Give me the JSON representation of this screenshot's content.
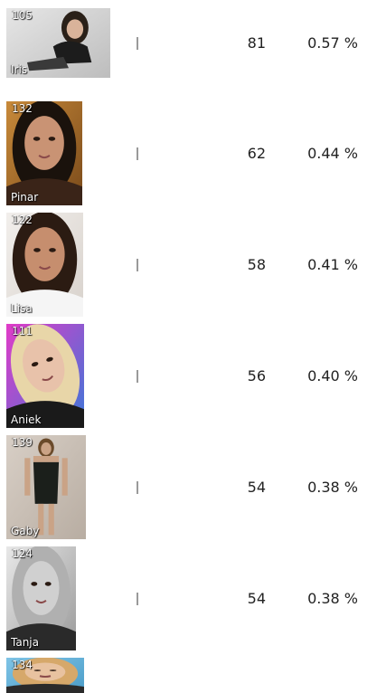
{
  "entries": [
    {
      "rank": "105",
      "name": "Iris",
      "votes": "81",
      "percent": "0.57 %",
      "bar_fraction": 0.57,
      "photo": {
        "bg": "#e6e6e6",
        "bg2": "#bdbdbd",
        "hair": "#2a2018",
        "skin": "#d9b39a",
        "cloth": "#1c1c1c",
        "pose": "lying"
      }
    },
    {
      "rank": "132",
      "name": "Pinar",
      "votes": "62",
      "percent": "0.44 %",
      "bar_fraction": 0.44,
      "photo": {
        "bg": "#c88a3a",
        "bg2": "#7a4a1a",
        "hair": "#1a120c",
        "skin": "#c99374",
        "cloth": "#3a2418",
        "pose": "close"
      }
    },
    {
      "rank": "122",
      "name": "Lisa",
      "votes": "58",
      "percent": "0.41 %",
      "bar_fraction": 0.41,
      "photo": {
        "bg": "#f2efec",
        "bg2": "#d8d2cc",
        "hair": "#2b1b12",
        "skin": "#c68e6e",
        "cloth": "#f5f5f5",
        "pose": "portrait"
      }
    },
    {
      "rank": "111",
      "name": "Aniek",
      "votes": "56",
      "percent": "0.40 %",
      "bar_fraction": 0.4,
      "photo": {
        "bg": "#e23bc8",
        "bg2": "#3b78d8",
        "hair": "#e8d6a8",
        "skin": "#e8c2aa",
        "cloth": "#1a1a1a",
        "pose": "tilted"
      }
    },
    {
      "rank": "139",
      "name": "Gaby",
      "votes": "54",
      "percent": "0.38 %",
      "bar_fraction": 0.38,
      "photo": {
        "bg": "#d8cfc6",
        "bg2": "#b8ada2",
        "hair": "#6a4a2a",
        "skin": "#caa386",
        "cloth": "#1b1f1b",
        "pose": "standing"
      }
    },
    {
      "rank": "124",
      "name": "Tanja",
      "votes": "54",
      "percent": "0.38 %",
      "bar_fraction": 0.38,
      "photo": {
        "bg": "#e8e8e8",
        "bg2": "#9a9a9a",
        "hair": "#b0b0b0",
        "skin": "#d0d0d0",
        "cloth": "#2a2a2a",
        "pose": "close"
      }
    },
    {
      "rank": "134",
      "name": "",
      "votes": "",
      "percent": "",
      "bar_fraction": 0,
      "photo": {
        "bg": "#7fc4e6",
        "bg2": "#4a9cc8",
        "hair": "#d6a86a",
        "skin": "#e8c2a0",
        "cloth": "#2a2a2a",
        "pose": "close"
      }
    }
  ]
}
